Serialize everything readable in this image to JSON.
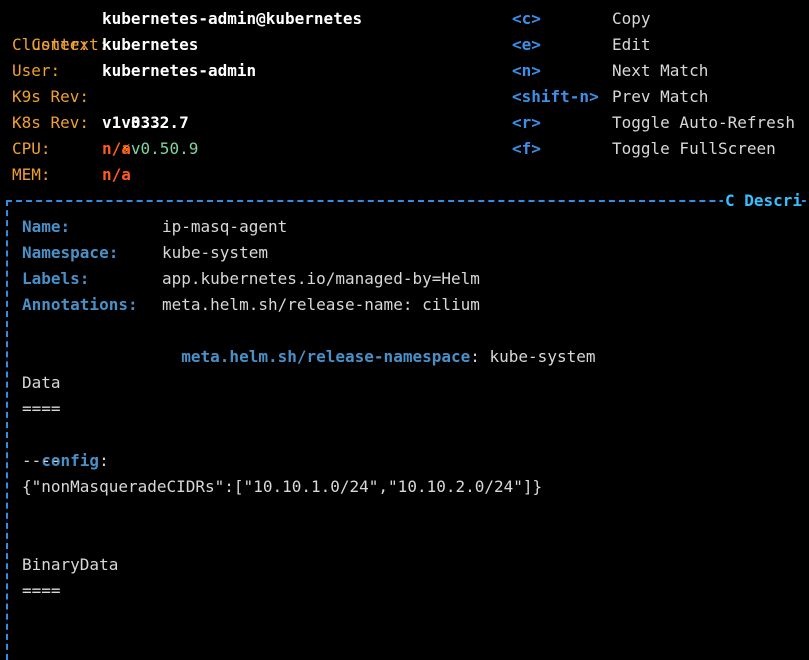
{
  "header": {
    "info": [
      {
        "label": "Context:",
        "value": "kubernetes-admin@kubernetes",
        "style": "white"
      },
      {
        "label": "Cluster:",
        "value": "kubernetes",
        "style": "white"
      },
      {
        "label": "User:",
        "value": "kubernetes-admin",
        "style": "white"
      },
      {
        "label": "K9s Rev:",
        "value": "v0.32.7",
        "style": "white",
        "extra": "v0.50.9"
      },
      {
        "label": "K8s Rev:",
        "value": "v1.33.2",
        "style": "white"
      },
      {
        "label": "CPU:",
        "value": "n/a",
        "style": "red"
      },
      {
        "label": "MEM:",
        "value": "n/a",
        "style": "red"
      }
    ],
    "shortcuts": [
      {
        "key": "<c>",
        "action": "Copy"
      },
      {
        "key": "<e>",
        "action": "Edit"
      },
      {
        "key": "<n>",
        "action": "Next Match"
      },
      {
        "key": "<shift-n>",
        "action": "Prev Match"
      },
      {
        "key": "<r>",
        "action": "Toggle Auto-Refresh"
      },
      {
        "key": "<f>",
        "action": "Toggle FullScreen"
      }
    ]
  },
  "panel": {
    "title": "C Descri",
    "fields": {
      "name_label": "Name:",
      "name_value": "ip-masq-agent",
      "namespace_label": "Namespace:",
      "namespace_value": "kube-system",
      "labels_label": "Labels:",
      "labels_value": "app.kubernetes.io/managed-by=Helm",
      "annotations_label": "Annotations:",
      "annotation1": "meta.helm.sh/release-name: cilium",
      "annotation2_key": "meta.helm.sh/release-namespace",
      "annotation2_rest": ": kube-system"
    },
    "data_heading": "Data",
    "data_rule": "====",
    "config_key": "config",
    "config_colon": ":",
    "config_rule": "----",
    "config_value": "{\"nonMasqueradeCIDRs\":[\"10.10.1.0/24\",\"10.10.2.0/24\"]}",
    "binary_heading": "BinaryData",
    "binary_rule": "===="
  }
}
